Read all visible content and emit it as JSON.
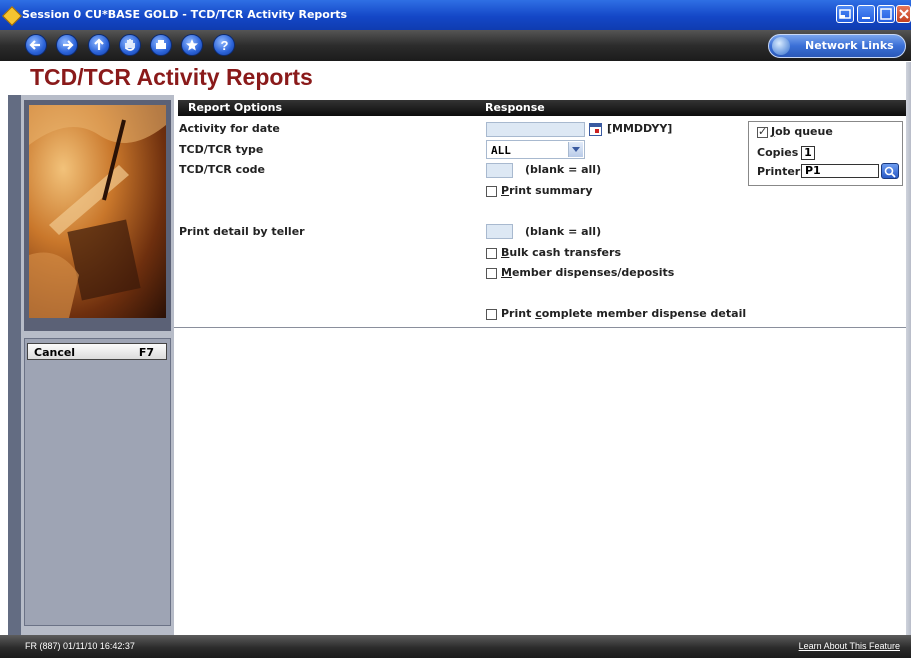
{
  "window": {
    "title": "Session 0 CU*BASE GOLD - TCD/TCR Activity Reports",
    "controls": [
      "minimize-icon",
      "restore-icon",
      "maximize-icon",
      "close-icon"
    ]
  },
  "toolbar": {
    "buttons": [
      "back-icon",
      "forward-icon",
      "up-icon",
      "stop-hand-icon",
      "print-icon",
      "favorites-star-icon",
      "help-icon"
    ],
    "network_links_label": "Network Links"
  },
  "page": {
    "title": "TCD/TCR Activity Reports"
  },
  "sidebar": {
    "cancel_label": "Cancel",
    "cancel_key": "F7"
  },
  "table": {
    "col_options": "Report Options",
    "col_response": "Response"
  },
  "form": {
    "activity_date_label": "Activity for date",
    "activity_date_value": "",
    "date_format": "[MMDDYY]",
    "type_label": "TCD/TCR type",
    "type_value": "ALL",
    "code_label": "TCD/TCR code",
    "code_value": "",
    "code_hint": "(blank = all)",
    "print_summary_first": "P",
    "print_summary_rest": "rint summary",
    "print_summary_checked": false,
    "teller_label": "Print detail by teller",
    "teller_value": "",
    "teller_hint": "(blank = all)",
    "bulk_first": "B",
    "bulk_rest": "ulk cash transfers",
    "bulk_checked": false,
    "member_first": "M",
    "member_rest": "ember dispenses/deposits",
    "member_checked": false,
    "complete_pre": "Print ",
    "complete_u": "c",
    "complete_rest": "omplete member dispense detail",
    "complete_checked": false
  },
  "job": {
    "job_queue_first": "J",
    "job_queue_rest": "ob queue",
    "job_queue_checked": true,
    "copies_label": "Copies",
    "copies_value": "1",
    "printer_label": "Printer",
    "printer_value": "P1"
  },
  "status": {
    "left": "FR (887) 01/11/10 16:42:37",
    "right": "Learn About This Feature"
  }
}
